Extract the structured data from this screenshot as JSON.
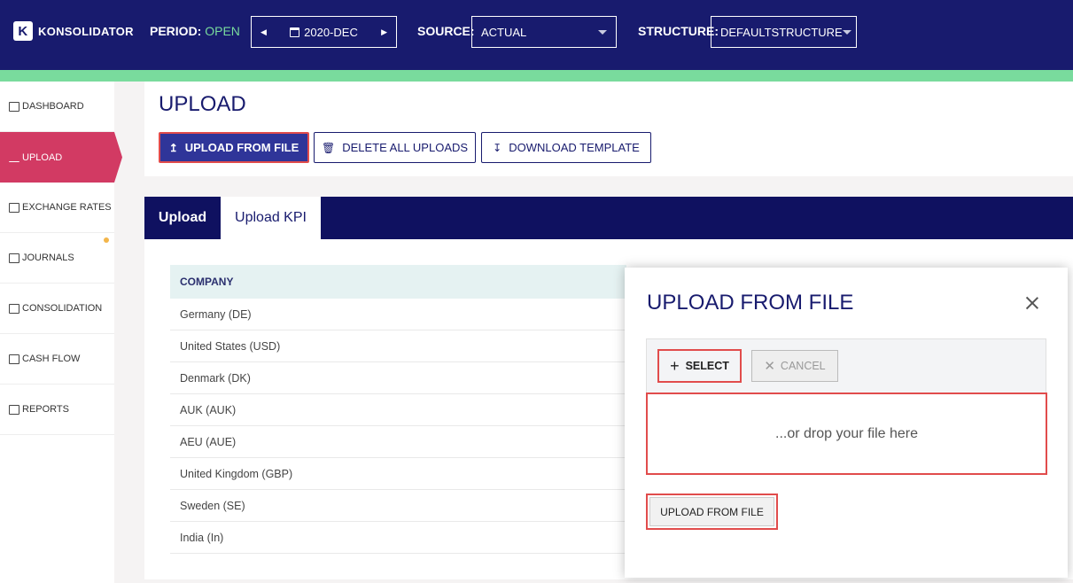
{
  "header": {
    "brand": "KONSOLIDATOR",
    "logo_letter": "K",
    "period_label": "PERIOD:",
    "period_status": "OPEN",
    "period_value": "2020-DEC",
    "source_label": "SOURCE:",
    "source_value": "ACTUAL",
    "structure_label": "STRUCTURE:",
    "structure_value": "DEFAULTSTRUCTURE"
  },
  "sidebar": {
    "items": [
      {
        "label": "DASHBOARD",
        "icon": "home-icon"
      },
      {
        "label": "UPLOAD",
        "icon": "upload-icon",
        "active": true
      },
      {
        "label": "EXCHANGE RATES",
        "icon": "bar-chart-icon"
      },
      {
        "label": "JOURNALS",
        "icon": "journal-icon",
        "notification": true
      },
      {
        "label": "CONSOLIDATION",
        "icon": "konsolidator-icon"
      },
      {
        "label": "CASH FLOW",
        "icon": "cash-icon"
      },
      {
        "label": "REPORTS",
        "icon": "line-chart-icon"
      }
    ]
  },
  "main": {
    "title": "UPLOAD",
    "actions": {
      "upload_from_file": "UPLOAD FROM FILE",
      "delete_all_uploads": "DELETE ALL UPLOADS",
      "download_template": "DOWNLOAD TEMPLATE"
    },
    "tabs": [
      {
        "label": "Upload",
        "active": false
      },
      {
        "label": "Upload KPI",
        "active": true
      }
    ],
    "table": {
      "header": "COMPANY",
      "rows": [
        "Germany (DE)",
        "United States (USD)",
        "Denmark (DK)",
        "AUK (AUK)",
        "AEU (AUE)",
        "United Kingdom (GBP)",
        "Sweden (SE)",
        "India (In)"
      ]
    }
  },
  "modal": {
    "title": "UPLOAD FROM FILE",
    "select_label": "SELECT",
    "cancel_label": "CANCEL",
    "drop_text": "...or drop your file here",
    "submit_label": "UPLOAD FROM FILE"
  },
  "colors": {
    "header_bg": "#181b6e",
    "accent_green": "#79db9d",
    "active_nav": "#d23a63",
    "highlight_red": "#e14c4c"
  }
}
